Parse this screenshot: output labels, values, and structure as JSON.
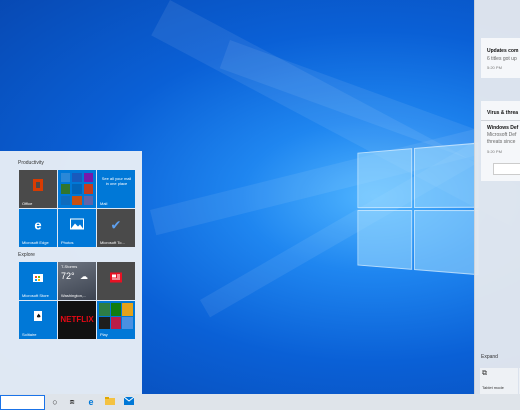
{
  "start_menu": {
    "groups": [
      {
        "title": "Productivity"
      },
      {
        "title": "Explore"
      }
    ],
    "tiles": {
      "office": {
        "label": "Office"
      },
      "mail": {
        "label": "Mail",
        "text": "See all your mail in one place"
      },
      "edge": {
        "label": "Microsoft Edge"
      },
      "photos": {
        "label": "Photos"
      },
      "todo": {
        "label": "Microsoft To..."
      },
      "store": {
        "label": "Microsoft Store"
      },
      "weather": {
        "label": "Washington,...",
        "condition": "T-Storms",
        "temp": "72°"
      },
      "news": {
        "label": ""
      },
      "solitaire": {
        "label": "Solitaire"
      },
      "netflix": {
        "label": "NETFLIX"
      },
      "play": {
        "label": "Play"
      }
    }
  },
  "action_center": {
    "notifications": [
      {
        "title": "Updates com",
        "text": "6 titles got up",
        "time": "5:20 PM"
      },
      {
        "section": "Virus & threa",
        "title": "Windows Def",
        "text1": "Microsoft Def",
        "text2": "threats since",
        "time": "5:20 PM"
      }
    ],
    "expand_label": "Expand",
    "tablet_mode_label": "Tablet mode"
  },
  "taskbar": {
    "search_value": "",
    "icons": [
      "cortana-icon",
      "task-view-icon",
      "edge-icon",
      "file-explorer-icon",
      "mail-icon"
    ]
  },
  "colors": {
    "tile_blue": "#0078d7",
    "tile_dark": "#4a4a4a",
    "office_red": "#d83b01",
    "netflix_red": "#e50914"
  }
}
